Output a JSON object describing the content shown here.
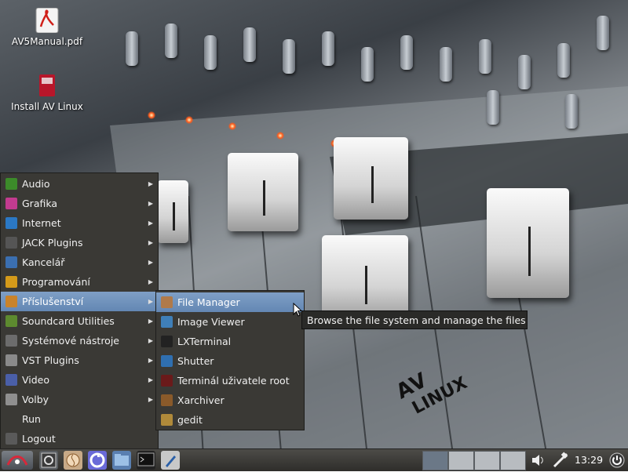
{
  "desktop": {
    "icons": [
      {
        "label": "AV5Manual.pdf",
        "icon": "pdf-file-icon"
      },
      {
        "label": "Install AV Linux",
        "icon": "installer-icon"
      }
    ],
    "wallpaper_logo": {
      "line1": "AV",
      "line2": "LINUX"
    }
  },
  "main_menu": {
    "items": [
      {
        "label": "Audio",
        "icon": "audio-icon",
        "color": "#3c8b2a",
        "submenu": true
      },
      {
        "label": "Grafika",
        "icon": "graphics-icon",
        "color": "#c23b8f",
        "submenu": true
      },
      {
        "label": "Internet",
        "icon": "internet-icon",
        "color": "#2b78c4",
        "submenu": true
      },
      {
        "label": "JACK Plugins",
        "icon": "jack-plugins-icon",
        "color": "#555555",
        "submenu": true
      },
      {
        "label": "Kancelář",
        "icon": "office-icon",
        "color": "#3b6fb0",
        "submenu": true
      },
      {
        "label": "Programování",
        "icon": "programming-icon",
        "color": "#d49a1a",
        "submenu": true
      },
      {
        "label": "Příslušenství",
        "icon": "accessories-icon",
        "color": "#c9832a",
        "submenu": true,
        "highlighted": true
      },
      {
        "label": "Soundcard Utilities",
        "icon": "soundcard-icon",
        "color": "#5d8a2f",
        "submenu": true
      },
      {
        "label": "Systémové nástroje",
        "icon": "system-tools-icon",
        "color": "#6c6c6c",
        "submenu": true
      },
      {
        "label": "VST Plugins",
        "icon": "vst-plugins-icon",
        "color": "#8a8a8a",
        "submenu": true
      },
      {
        "label": "Video",
        "icon": "video-icon",
        "color": "#4a5fa8",
        "submenu": true
      },
      {
        "label": "Volby",
        "icon": "settings-icon",
        "color": "#8f8f8f",
        "submenu": true
      },
      {
        "label": "Run",
        "icon": "",
        "color": "",
        "submenu": false
      },
      {
        "label": "Logout",
        "icon": "logout-icon",
        "color": "#5a5a5a",
        "submenu": false
      }
    ]
  },
  "sub_menu": {
    "items": [
      {
        "label": "File Manager",
        "icon": "file-manager-icon",
        "color": "#b07a4a",
        "highlighted": true
      },
      {
        "label": "Image Viewer",
        "icon": "image-viewer-icon",
        "color": "#3f7fb8"
      },
      {
        "label": "LXTerminal",
        "icon": "terminal-icon",
        "color": "#222222"
      },
      {
        "label": "Shutter",
        "icon": "shutter-icon",
        "color": "#2f6fb0"
      },
      {
        "label": "Terminál uživatele root",
        "icon": "root-terminal-icon",
        "color": "#6a1a1a"
      },
      {
        "label": "Xarchiver",
        "icon": "archiver-icon",
        "color": "#8a5a2a"
      },
      {
        "label": "gedit",
        "icon": "gedit-icon",
        "color": "#b08a3a"
      }
    ]
  },
  "tooltip": {
    "text": "Browse the file system and manage the files"
  },
  "taskbar": {
    "launchers": [
      {
        "icon": "start-menu-icon"
      },
      {
        "icon": "system-monitor-icon"
      },
      {
        "icon": "browser-icon"
      },
      {
        "icon": "synaptic-icon"
      },
      {
        "icon": "file-manager-icon"
      },
      {
        "icon": "terminal-icon"
      },
      {
        "icon": "text-editor-icon"
      }
    ],
    "workspaces": 4,
    "active_workspace": 1,
    "clock": "13:29"
  }
}
